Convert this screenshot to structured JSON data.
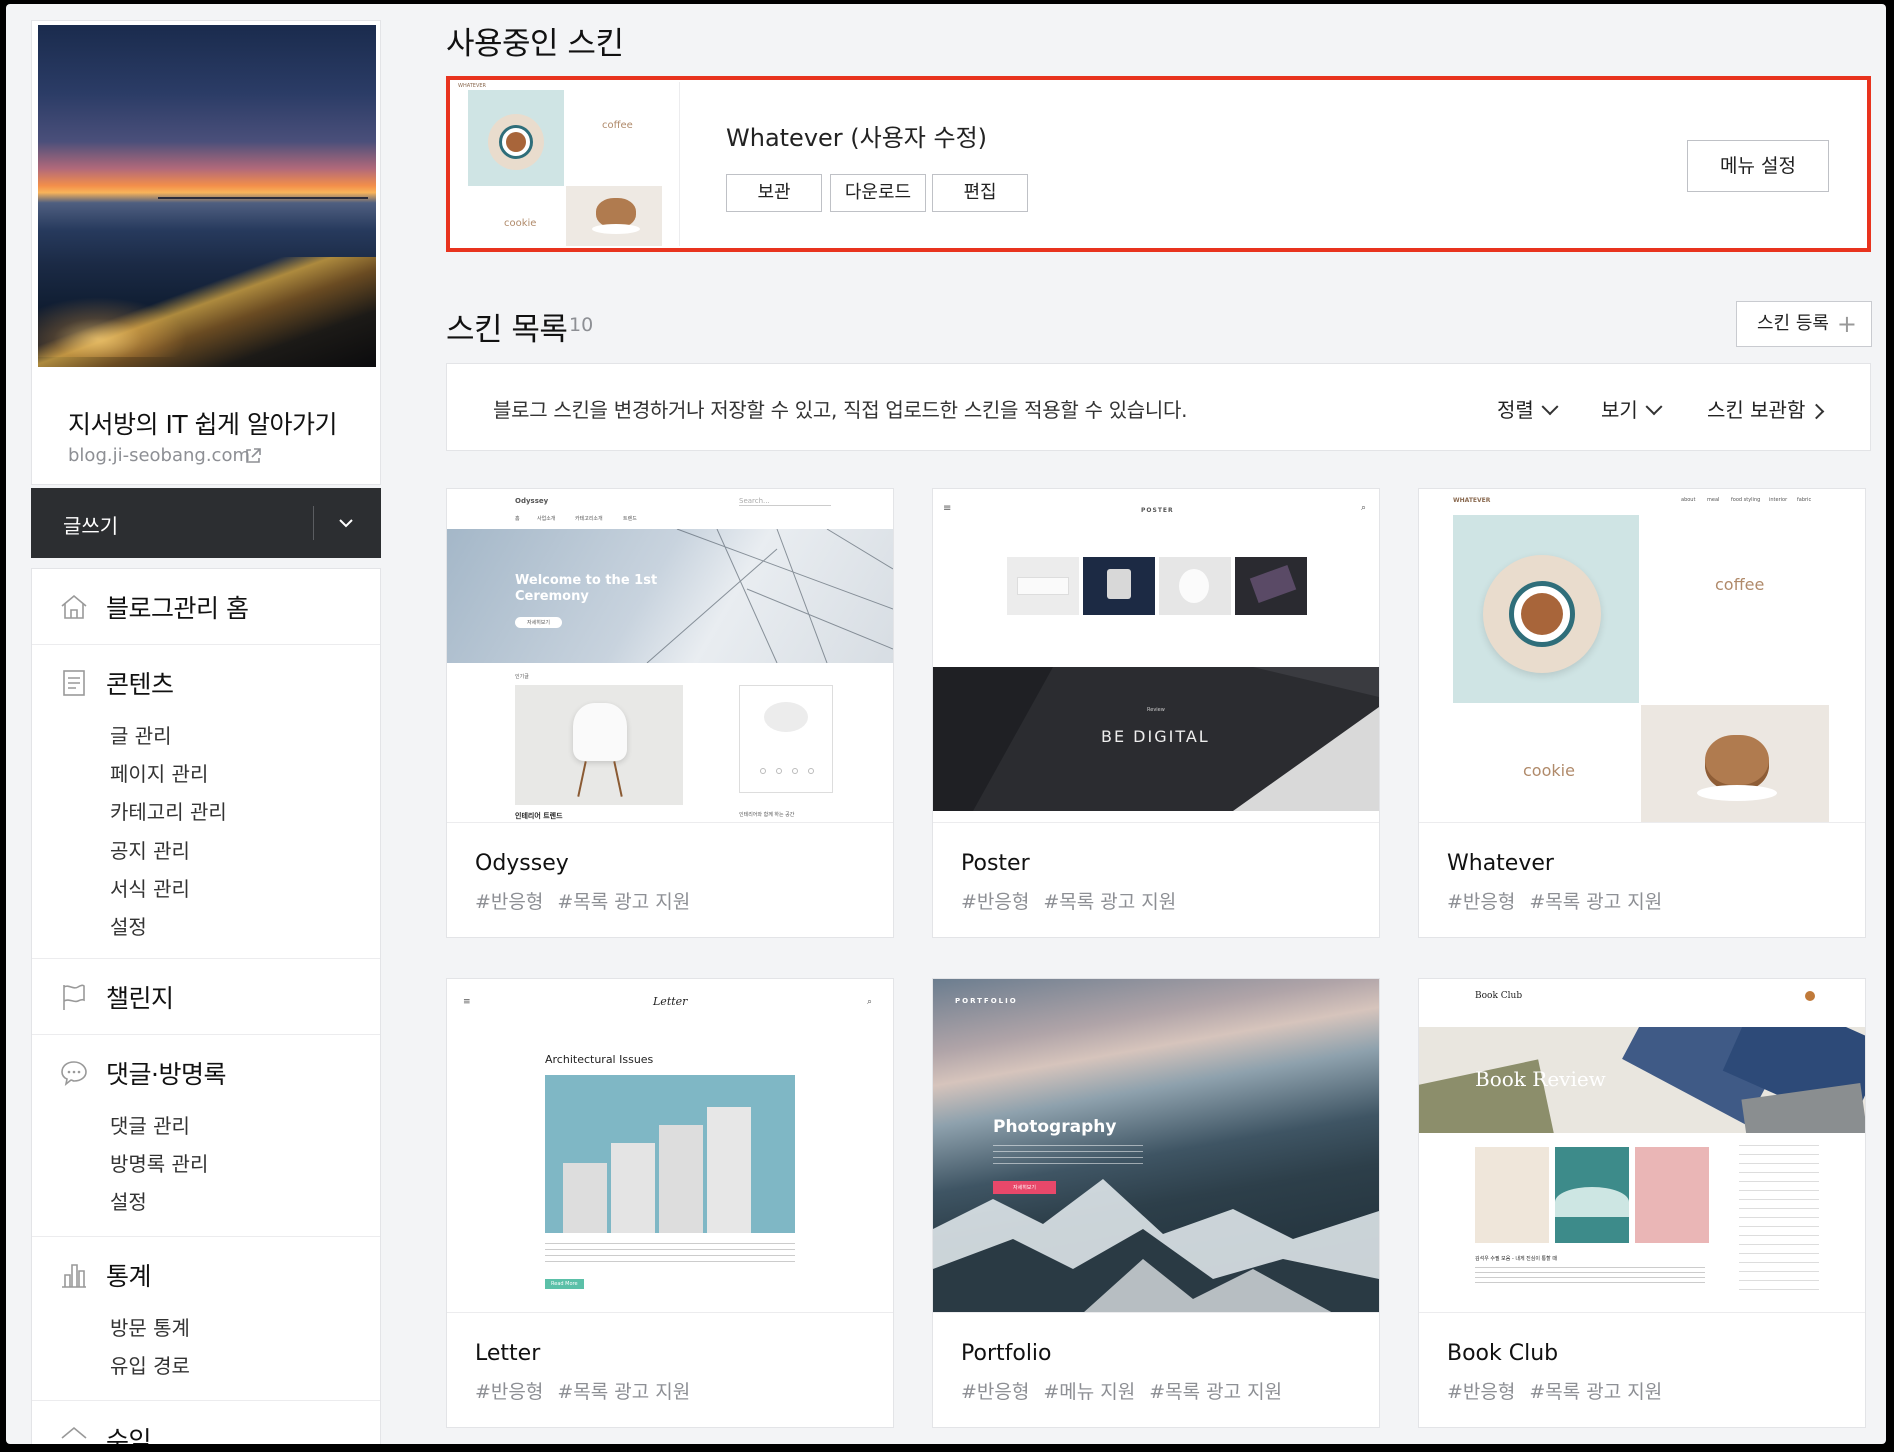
{
  "sidebar": {
    "blog_title": "지서방의 IT 쉽게 알아가기",
    "blog_url": "blog.ji-seobang.com",
    "write_label": "글쓰기",
    "sections": [
      {
        "label": "블로그관리 홈",
        "items": []
      },
      {
        "label": "콘텐츠",
        "items": [
          "글 관리",
          "페이지 관리",
          "카테고리 관리",
          "공지 관리",
          "서식 관리",
          "설정"
        ]
      },
      {
        "label": "챌린지",
        "items": []
      },
      {
        "label": "댓글·방명록",
        "items": [
          "댓글 관리",
          "방명록 관리",
          "설정"
        ]
      },
      {
        "label": "통계",
        "items": [
          "방문 통계",
          "유입 경로"
        ]
      },
      {
        "label": "수익",
        "items": []
      }
    ]
  },
  "current_skin": {
    "heading": "사용중인 스킨",
    "name": "Whatever (사용자 수정)",
    "buttons": [
      "보관",
      "다운로드",
      "편집"
    ],
    "menu_button": "메뉴 설정",
    "thumb_labels": [
      "coffee",
      "cookie",
      "WHATEVER"
    ]
  },
  "skin_list": {
    "heading": "스킨 목록",
    "count": "10",
    "register_label": "스킨 등록",
    "info_text": "블로그 스킨을 변경하거나 저장할 수 있고, 직접 업로드한 스킨을 적용할 수 있습니다.",
    "sort_label": "정렬",
    "view_label": "보기",
    "storage_label": "스킨 보관함",
    "cards": [
      {
        "name": "Odyssey",
        "tags": [
          "#반응형",
          "#목록 광고 지원"
        ],
        "thumb": {
          "brand": "Odyssey",
          "nav": [
            "홈",
            "사업소개",
            "카테고리소개",
            "트렌드"
          ],
          "search": "Search...",
          "hero": "Welcome to the 1st Ceremony",
          "hero_btn": "자세히보기",
          "section_label": "인기글",
          "post_title": "인테리어 트렌드",
          "side_caption": "인테리어와 함께 하는 공간"
        }
      },
      {
        "name": "Poster",
        "tags": [
          "#반응형",
          "#목록 광고 지원"
        ],
        "thumb": {
          "brand": "POSTER",
          "banner_kicker": "Review",
          "banner": "BE DIGITAL"
        }
      },
      {
        "name": "Whatever",
        "tags": [
          "#반응형",
          "#목록 광고 지원"
        ],
        "thumb": {
          "brand": "WHATEVER",
          "nav": [
            "about",
            "meal",
            "food styling",
            "interior",
            "fabric"
          ],
          "word1": "coffee",
          "word2": "cookie"
        }
      },
      {
        "name": "Letter",
        "tags": [
          "#반응형",
          "#목록 광고 지원"
        ],
        "thumb": {
          "brand": "Letter",
          "post_title": "Architectural Issues",
          "btn": "Read More"
        }
      },
      {
        "name": "Portfolio",
        "tags": [
          "#반응형",
          "#메뉴 지원",
          "#목록 광고 지원"
        ],
        "thumb": {
          "brand": "PORTFOLIO",
          "hero": "Photography",
          "btn": "자세히보기"
        }
      },
      {
        "name": "Book Club",
        "tags": [
          "#반응형",
          "#목록 광고 지원"
        ],
        "thumb": {
          "brand": "Book Club",
          "hero": "Book Review",
          "post_title": "김석우 수필 모음 - 내게 진심이 통할 때"
        }
      }
    ]
  },
  "colors": {
    "accent_border": "#e8331e",
    "write_bg": "#2c2e31",
    "page_bg": "#f3f4f6"
  }
}
